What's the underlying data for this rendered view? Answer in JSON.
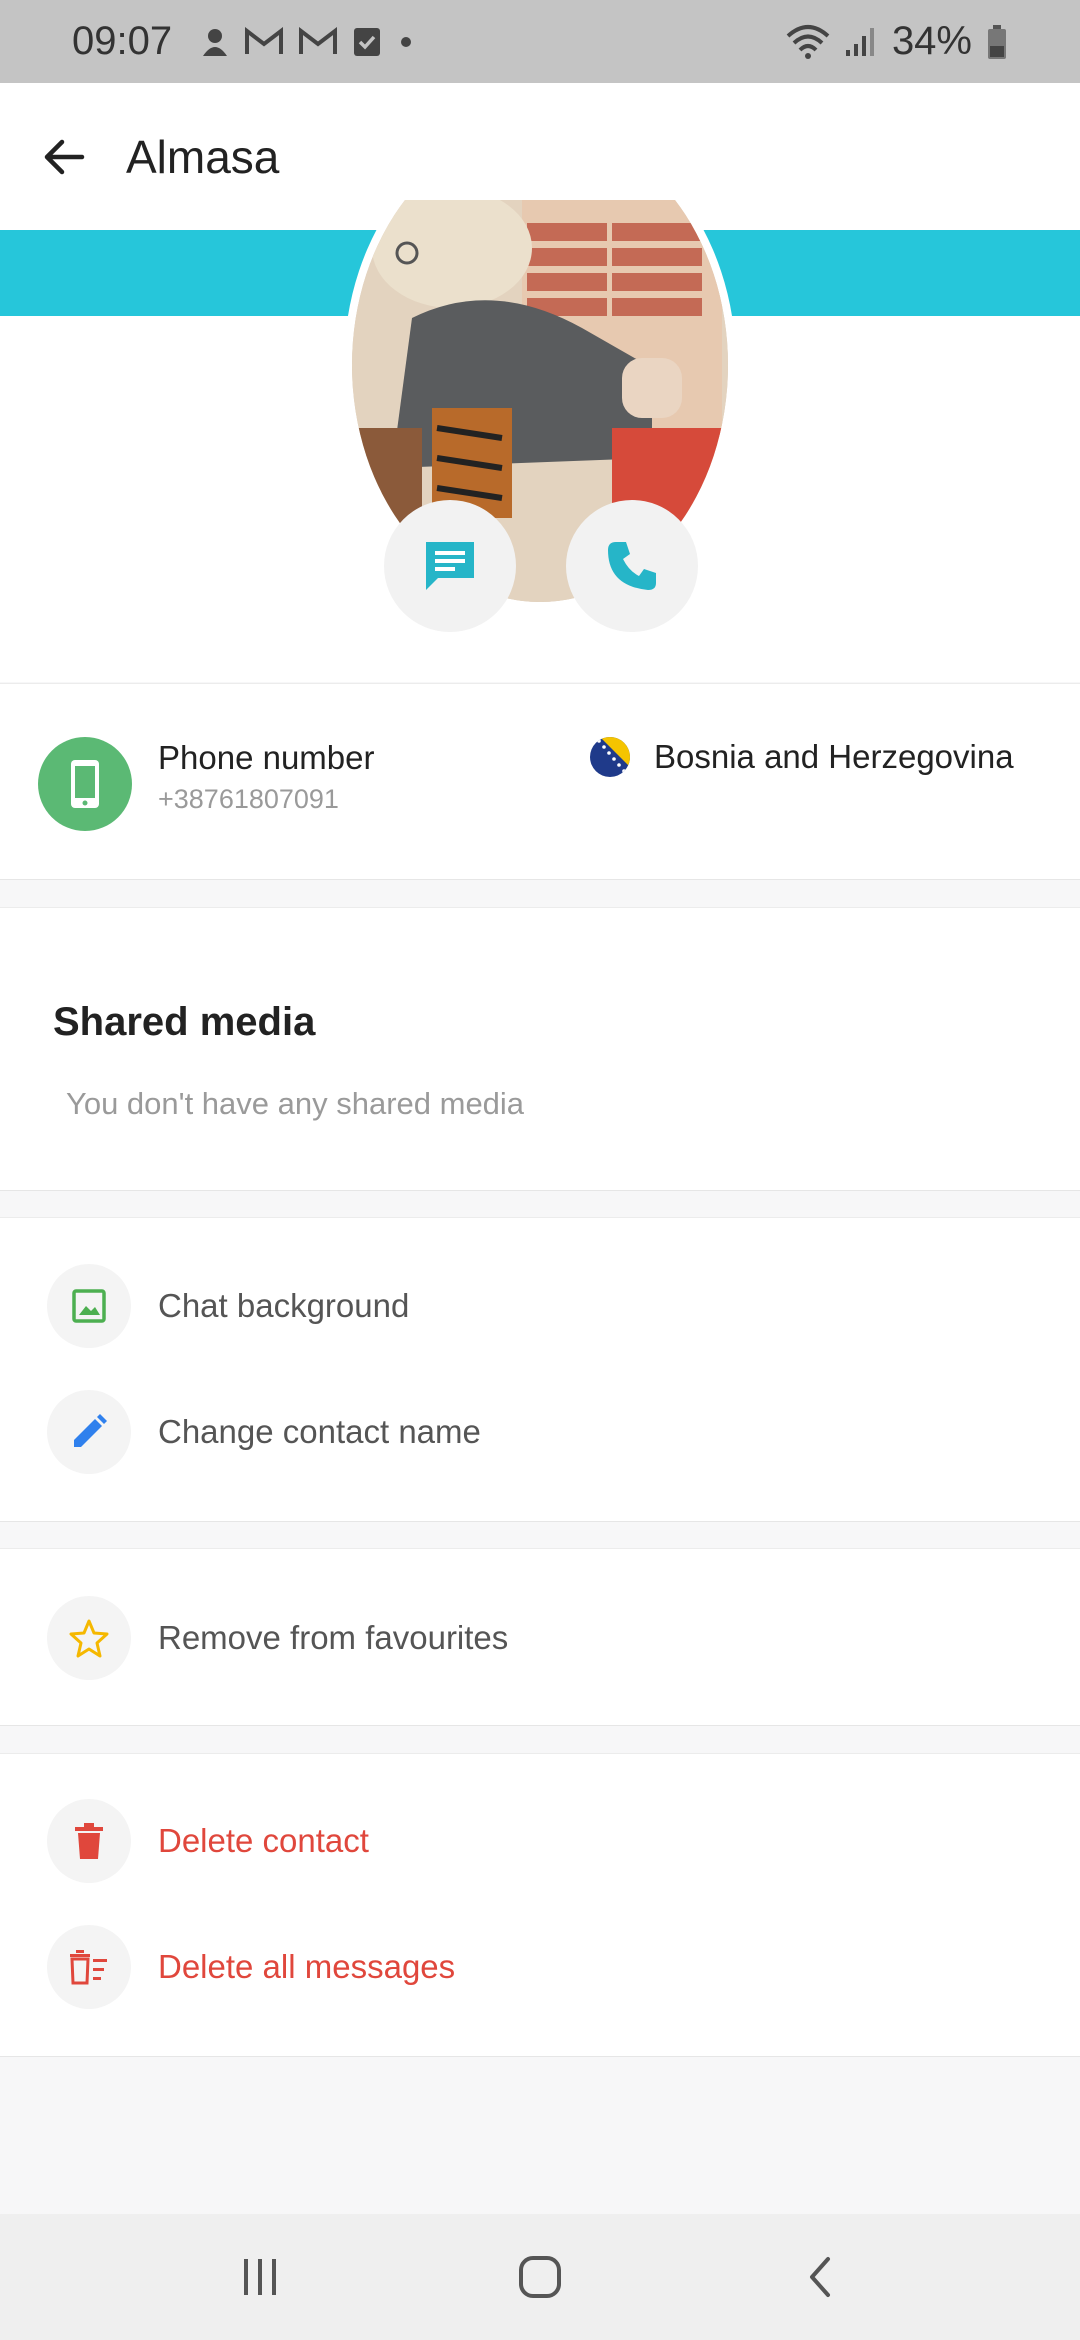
{
  "status_bar": {
    "time": "09:07",
    "battery": "34%",
    "left_icons": [
      "assistant-icon",
      "gmail-icon",
      "gmail-icon",
      "task-check-icon",
      "dot-icon"
    ],
    "right_icons": [
      "wifi-icon",
      "signal-icon",
      "battery-icon"
    ]
  },
  "app_bar": {
    "title": "Almasa",
    "back_icon": "arrow-back-icon"
  },
  "profile": {
    "accent_color": "#26c6da",
    "actions": [
      {
        "name": "message",
        "icon": "chat-icon"
      },
      {
        "name": "call",
        "icon": "phone-icon"
      }
    ]
  },
  "phone_info": {
    "label": "Phone number",
    "value": "+38761807091",
    "country": "Bosnia and Herzegovina",
    "icon_color": "#5bb974"
  },
  "shared_media": {
    "title": "Shared media",
    "empty_text": "You don't have any shared media"
  },
  "options": {
    "chat_background": "Chat background",
    "change_contact_name": "Change contact name",
    "remove_from_favourites": "Remove from favourites",
    "delete_contact": "Delete contact",
    "delete_all_messages": "Delete all messages"
  },
  "colors": {
    "danger": "#e0473c",
    "star": "#f5b800",
    "edit": "#2f80ed",
    "image": "#4caf50"
  },
  "nav_bar": {
    "buttons": [
      "recent-apps-icon",
      "home-icon",
      "back-icon"
    ]
  }
}
